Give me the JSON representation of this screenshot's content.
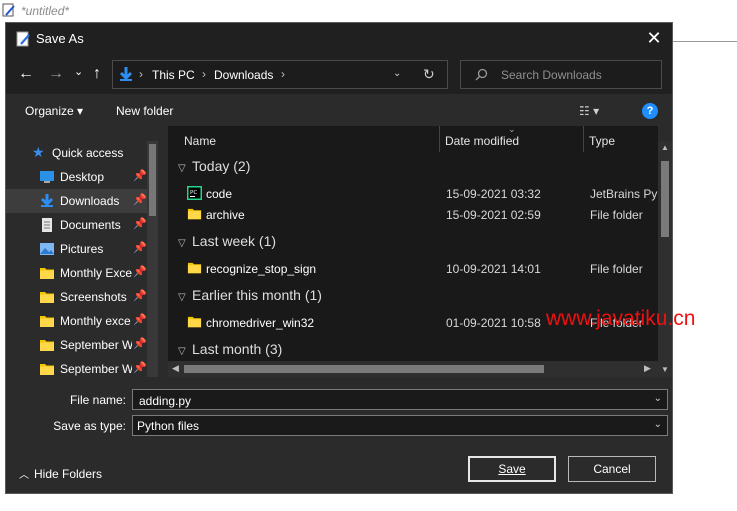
{
  "background": {
    "window_title": "*untitled*"
  },
  "dialog": {
    "title": "Save As",
    "close_symbol": "✕",
    "nav": {
      "back": "←",
      "forward": "→",
      "recent": "⌄",
      "up": "↑"
    },
    "address": {
      "crumbs": [
        "This PC",
        "Downloads"
      ],
      "separator": "›"
    },
    "search": {
      "placeholder": "Search Downloads"
    },
    "toolbar": {
      "organize": "Organize ▾",
      "new_folder": "New folder",
      "view_label": "☷ ▾",
      "help": "?"
    },
    "sidebar": {
      "quick_access": "Quick access",
      "items": [
        {
          "label": "Desktop",
          "icon": "desktop-icon",
          "pinned": true
        },
        {
          "label": "Downloads",
          "icon": "downloads-icon",
          "pinned": true,
          "selected": true
        },
        {
          "label": "Documents",
          "icon": "documents-icon",
          "pinned": true
        },
        {
          "label": "Pictures",
          "icon": "pictures-icon",
          "pinned": true
        },
        {
          "label": "Monthly Exce",
          "icon": "folder-icon",
          "pinned": true
        },
        {
          "label": "Screenshots",
          "icon": "folder-icon",
          "pinned": true
        },
        {
          "label": "Monthly exce",
          "icon": "folder-icon",
          "pinned": true
        },
        {
          "label": "September W",
          "icon": "folder-icon",
          "pinned": true
        },
        {
          "label": "September W",
          "icon": "folder-icon",
          "pinned": true
        }
      ]
    },
    "columns": {
      "name": "Name",
      "date": "Date modified",
      "type": "Type"
    },
    "groups": [
      {
        "label": "Today (2)",
        "files": [
          {
            "name": "code",
            "date": "15-09-2021 03:32",
            "type": "JetBrains PyC",
            "icon": "pycharm-icon"
          },
          {
            "name": "archive",
            "date": "15-09-2021 02:59",
            "type": "File folder",
            "icon": "folder-icon"
          }
        ]
      },
      {
        "label": "Last week (1)",
        "files": [
          {
            "name": "recognize_stop_sign",
            "date": "10-09-2021 14:01",
            "type": "File folder",
            "icon": "folder-icon"
          }
        ]
      },
      {
        "label": "Earlier this month (1)",
        "files": [
          {
            "name": "chromedriver_win32",
            "date": "01-09-2021 10:58",
            "type": "File folder",
            "icon": "folder-icon"
          }
        ]
      },
      {
        "label": "Last month (3)",
        "files": []
      }
    ],
    "filename": {
      "label": "File name:",
      "value": "adding.py"
    },
    "savetype": {
      "label": "Save as type:",
      "value": "Python files"
    },
    "hide_folders": "Hide Folders",
    "save": "Save",
    "cancel": "Cancel"
  },
  "watermark": "www.javatiku.cn",
  "colors": {
    "accent": "#1f8fff",
    "folder": "#f5c400",
    "watermark": "#f01010"
  }
}
